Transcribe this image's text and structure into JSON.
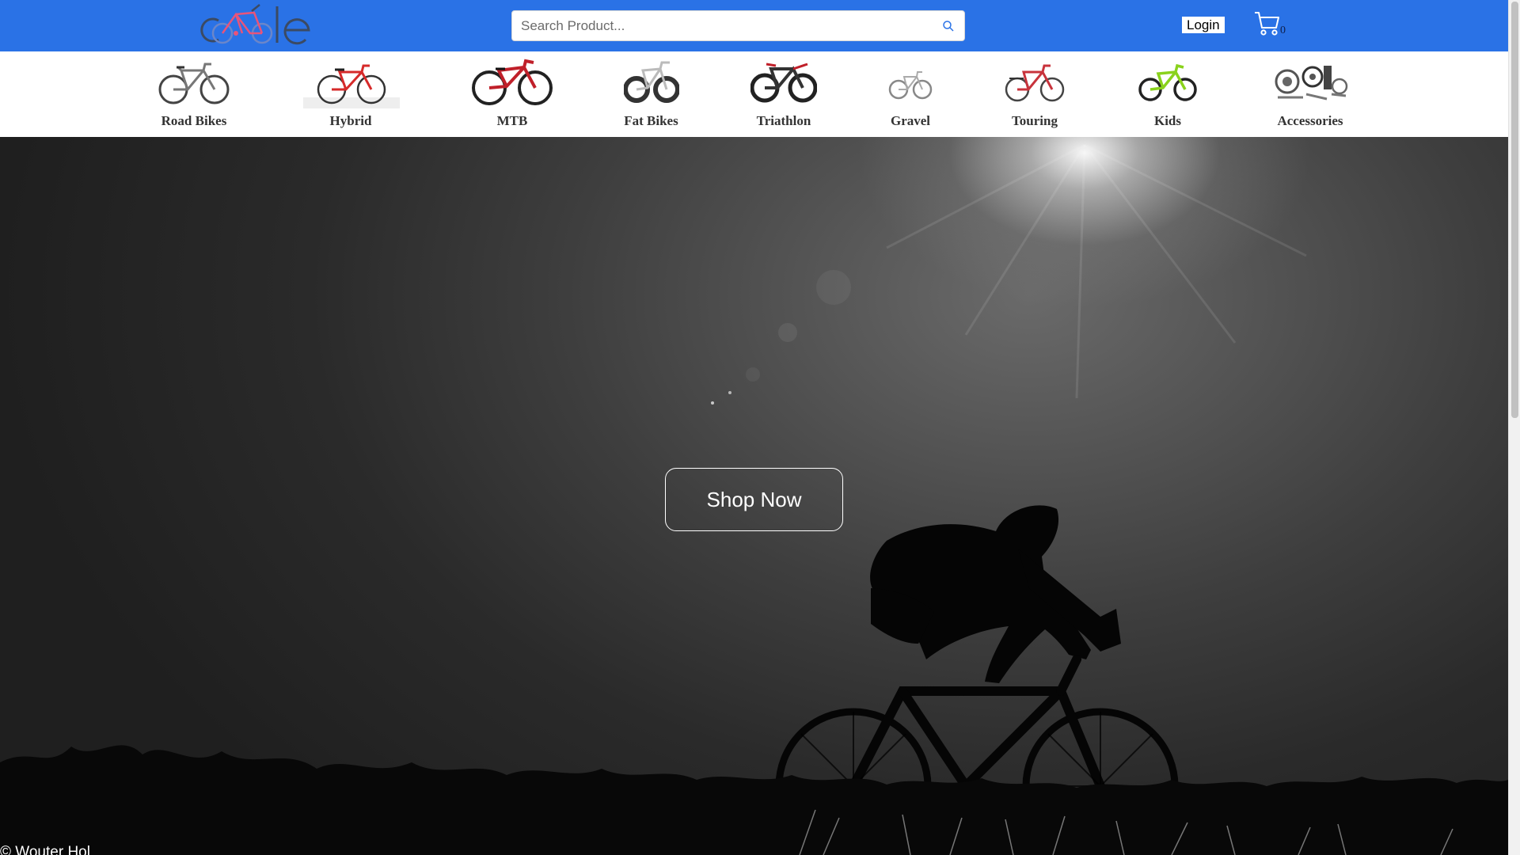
{
  "header": {
    "logo_alt": "cycle",
    "search_placeholder": "Search Product...",
    "login_label": "Login",
    "cart_count": "0"
  },
  "categories": [
    {
      "label": "Road Bikes",
      "icon": "road-bike-icon"
    },
    {
      "label": "Hybrid",
      "icon": "hybrid-bike-icon"
    },
    {
      "label": "MTB",
      "icon": "mtb-bike-icon"
    },
    {
      "label": "Fat Bikes",
      "icon": "fat-bike-icon"
    },
    {
      "label": "Triathlon",
      "icon": "triathlon-bike-icon"
    },
    {
      "label": "Gravel",
      "icon": "gravel-bike-icon"
    },
    {
      "label": "Touring",
      "icon": "touring-bike-icon"
    },
    {
      "label": "Kids",
      "icon": "kids-bike-icon"
    },
    {
      "label": "Accessories",
      "icon": "accessories-icon"
    }
  ],
  "hero": {
    "cta_label": "Shop Now",
    "credit": "© Wouter Hol"
  },
  "colors": {
    "header_bg": "#2a72e6",
    "category_bg": "#ffffff"
  }
}
